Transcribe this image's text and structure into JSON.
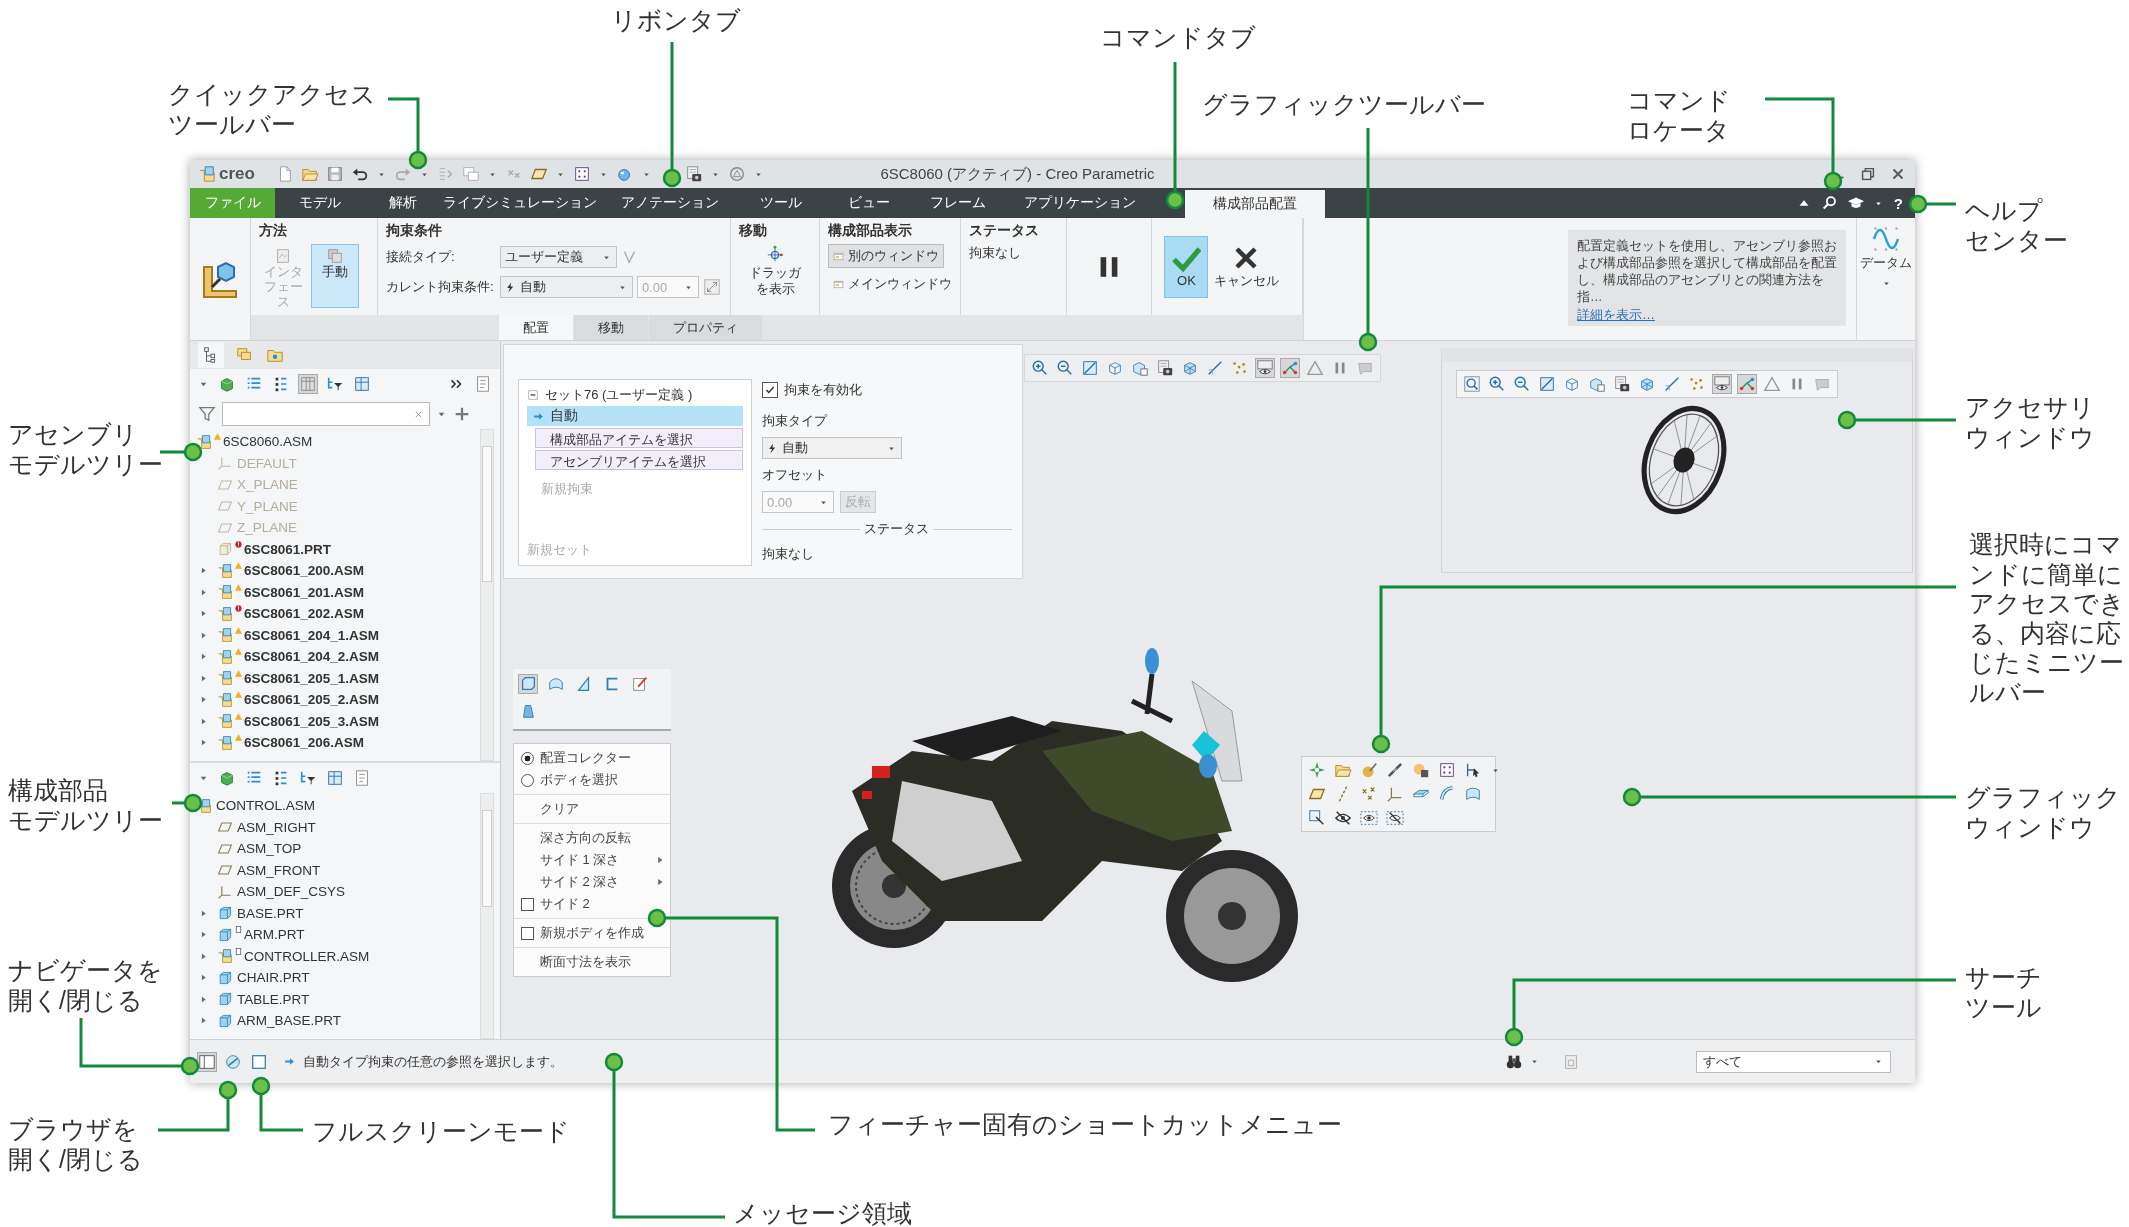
{
  "window": {
    "logo": "creo",
    "title": "6SC8060 (アクティブ) - Creo Parametric"
  },
  "ribbon_tabs": [
    {
      "label": "ファイル",
      "kind": "file",
      "selected": false
    },
    {
      "label": "モデル",
      "kind": "standard",
      "selected": false
    },
    {
      "label": "解析",
      "kind": "standard",
      "selected": false
    },
    {
      "label": "ライブシミュレーション",
      "kind": "standard",
      "selected": false
    },
    {
      "label": "アノテーション",
      "kind": "standard",
      "selected": false
    },
    {
      "label": "ツール",
      "kind": "standard",
      "selected": false
    },
    {
      "label": "ビュー",
      "kind": "standard",
      "selected": false
    },
    {
      "label": "フレーム",
      "kind": "standard",
      "selected": false
    },
    {
      "label": "アプリケーション",
      "kind": "standard",
      "selected": false
    },
    {
      "label": "構成部品配置",
      "kind": "standard",
      "selected": true
    }
  ],
  "help_button": "?",
  "ribbon": {
    "method": {
      "title": "方法",
      "buttons": [
        {
          "label": "インタフェース",
          "selected": false,
          "disabled": true
        },
        {
          "label": "手動",
          "selected": true,
          "disabled": false
        }
      ]
    },
    "constraints": {
      "title": "拘束条件",
      "connection_label": "接続タイプ:",
      "connection_value": "ユーザー定義",
      "current_label": "カレント拘束条件:",
      "current_value": "自動",
      "offset_value": "0.00"
    },
    "move": {
      "title": "移動",
      "button": "ドラッガを表示"
    },
    "component_display": {
      "title": "構成部品表示",
      "buttons": [
        {
          "label": "別のウィンドウ",
          "selected": true
        },
        {
          "label": "メインウィンドウ",
          "selected": false
        }
      ]
    },
    "status": {
      "title": "ステータス",
      "text": "拘束なし"
    },
    "ok": {
      "label": "OK",
      "selected": true
    },
    "cancel": {
      "label": "キャンセル"
    },
    "info": {
      "text": "配置定義セットを使用し、アセンブリ参照および構成部品参照を選択して構成部品を配置し、構成部品のアセンブリとの関連方法を指…",
      "link": "詳細を表示…"
    },
    "datum": {
      "label": "データム"
    }
  },
  "dashboard_tabs": [
    {
      "label": "配置",
      "selected": true
    },
    {
      "label": "移動",
      "selected": false
    },
    {
      "label": "プロパティ",
      "selected": false
    }
  ],
  "assembly_tree": {
    "root": {
      "name": "6SC8060.ASM",
      "kind": "assembly",
      "warning": true,
      "error": false,
      "note": false,
      "highlighted": false,
      "dimmed": false,
      "children": [
        {
          "name": "DEFAULT",
          "kind": "csys",
          "warning": false,
          "error": false,
          "note": false,
          "has_children": false,
          "highlighted": false,
          "dimmed": true
        },
        {
          "name": "X_PLANE",
          "kind": "plane",
          "warning": false,
          "error": false,
          "note": false,
          "has_children": false,
          "highlighted": false,
          "dimmed": true
        },
        {
          "name": "Y_PLANE",
          "kind": "plane",
          "warning": false,
          "error": false,
          "note": false,
          "has_children": false,
          "highlighted": false,
          "dimmed": true
        },
        {
          "name": "Z_PLANE",
          "kind": "plane",
          "warning": false,
          "error": false,
          "note": false,
          "has_children": false,
          "highlighted": false,
          "dimmed": true
        },
        {
          "name": "6SC8061.PRT",
          "kind": "part_light",
          "warning": false,
          "error": true,
          "note": false,
          "has_children": false,
          "highlighted": true,
          "dimmed": false
        },
        {
          "name": "6SC8061_200.ASM",
          "kind": "assembly",
          "warning": true,
          "error": false,
          "note": false,
          "has_children": true,
          "highlighted": true,
          "dimmed": false
        },
        {
          "name": "6SC8061_201.ASM",
          "kind": "assembly",
          "warning": true,
          "error": false,
          "note": false,
          "has_children": true,
          "highlighted": true,
          "dimmed": false
        },
        {
          "name": "6SC8061_202.ASM",
          "kind": "assembly",
          "warning": false,
          "error": true,
          "note": false,
          "has_children": true,
          "highlighted": true,
          "dimmed": false
        },
        {
          "name": "6SC8061_204_1.ASM",
          "kind": "assembly",
          "warning": true,
          "error": false,
          "note": false,
          "has_children": true,
          "highlighted": true,
          "dimmed": false
        },
        {
          "name": "6SC8061_204_2.ASM",
          "kind": "assembly",
          "warning": true,
          "error": false,
          "note": false,
          "has_children": true,
          "highlighted": true,
          "dimmed": false
        },
        {
          "name": "6SC8061_205_1.ASM",
          "kind": "assembly",
          "warning": true,
          "error": false,
          "note": false,
          "has_children": true,
          "highlighted": true,
          "dimmed": false
        },
        {
          "name": "6SC8061_205_2.ASM",
          "kind": "assembly",
          "warning": true,
          "error": false,
          "note": false,
          "has_children": true,
          "highlighted": true,
          "dimmed": false
        },
        {
          "name": "6SC8061_205_3.ASM",
          "kind": "assembly",
          "warning": true,
          "error": false,
          "note": false,
          "has_children": true,
          "highlighted": true,
          "dimmed": false
        },
        {
          "name": "6SC8061_206.ASM",
          "kind": "assembly",
          "warning": true,
          "error": false,
          "note": false,
          "has_children": true,
          "highlighted": true,
          "dimmed": false
        }
      ]
    }
  },
  "component_tree": {
    "root": {
      "name": "CONTROL.ASM",
      "kind": "assembly",
      "warning": false,
      "error": false,
      "note": false,
      "highlighted": false,
      "dimmed": false,
      "children": [
        {
          "name": "ASM_RIGHT",
          "kind": "plane",
          "warning": false,
          "error": false,
          "note": false,
          "has_children": false,
          "highlighted": false,
          "dimmed": false
        },
        {
          "name": "ASM_TOP",
          "kind": "plane",
          "warning": false,
          "error": false,
          "note": false,
          "has_children": false,
          "highlighted": false,
          "dimmed": false
        },
        {
          "name": "ASM_FRONT",
          "kind": "plane",
          "warning": false,
          "error": false,
          "note": false,
          "has_children": false,
          "highlighted": false,
          "dimmed": false
        },
        {
          "name": "ASM_DEF_CSYS",
          "kind": "csys",
          "warning": false,
          "error": false,
          "note": false,
          "has_children": false,
          "highlighted": false,
          "dimmed": false
        },
        {
          "name": "BASE.PRT",
          "kind": "part",
          "warning": false,
          "error": false,
          "note": false,
          "has_children": true,
          "highlighted": false,
          "dimmed": false
        },
        {
          "name": "ARM.PRT",
          "kind": "part",
          "warning": false,
          "error": false,
          "note": true,
          "has_children": true,
          "highlighted": false,
          "dimmed": false
        },
        {
          "name": "CONTROLLER.ASM",
          "kind": "assembly",
          "warning": false,
          "error": false,
          "note": true,
          "has_children": true,
          "highlighted": false,
          "dimmed": false
        },
        {
          "name": "CHAIR.PRT",
          "kind": "part",
          "warning": false,
          "error": false,
          "note": false,
          "has_children": true,
          "highlighted": false,
          "dimmed": false
        },
        {
          "name": "TABLE.PRT",
          "kind": "part",
          "warning": false,
          "error": false,
          "note": false,
          "has_children": true,
          "highlighted": false,
          "dimmed": false
        },
        {
          "name": "ARM_BASE.PRT",
          "kind": "part",
          "warning": false,
          "error": false,
          "note": false,
          "has_children": true,
          "highlighted": false,
          "dimmed": false
        }
      ]
    }
  },
  "placement_panel": {
    "set_title": "セット76 (ユーザー定義 )",
    "set_expanded": true,
    "constraint": {
      "label": "自動",
      "selected": true
    },
    "references": [
      "構成部品アイテムを選択",
      "アセンブリアイテムを選択"
    ],
    "new_constraint": "新規拘束",
    "new_set": "新規セット",
    "enable_constraint": {
      "label": "拘束を有効化",
      "checked": true
    },
    "constraint_type_label": "拘束タイプ",
    "constraint_type_value": "自動",
    "offset_label": "オフセット",
    "offset_value": "0.00",
    "offset_disabled": true,
    "flip": {
      "label": "反転",
      "disabled": true
    },
    "status_label": "ステータス",
    "status_text": "拘束なし"
  },
  "graphic_toolbar": [
    {
      "on": false
    },
    {
      "on": false
    },
    {
      "on": false
    },
    {
      "on": false
    },
    {
      "on": false
    },
    {
      "on": false
    },
    {
      "on": false
    },
    {
      "on": false
    },
    {
      "on": false
    },
    {
      "on": true
    },
    {
      "on": true
    },
    {
      "on": false
    },
    {
      "on": false
    },
    {
      "on": false
    }
  ],
  "accessory_toolbar": [
    {
      "on": false
    },
    {
      "on": false
    },
    {
      "on": false
    },
    {
      "on": false
    },
    {
      "on": false
    },
    {
      "on": false
    },
    {
      "on": false
    },
    {
      "on": false
    },
    {
      "on": false
    },
    {
      "on": false
    },
    {
      "on": true
    },
    {
      "on": true
    },
    {
      "on": false
    },
    {
      "on": false
    },
    {
      "on": false
    }
  ],
  "shortcut_toolbar": [
    {
      "on": true
    },
    {
      "on": false
    },
    {
      "on": false
    },
    {
      "on": false
    },
    {
      "on": false
    },
    {
      "on": false
    }
  ],
  "shortcut_menu": [
    [
      {
        "kind": "radio",
        "label": "配置コレクター",
        "checked": true
      },
      {
        "kind": "radio",
        "label": "ボディを選択",
        "checked": false
      }
    ],
    [
      {
        "kind": "action",
        "label": "クリア"
      }
    ],
    [
      {
        "kind": "action",
        "label": "深さ方向の反転"
      },
      {
        "kind": "submenu",
        "label": "サイド 1 深さ"
      },
      {
        "kind": "submenu",
        "label": "サイド 2 深さ"
      },
      {
        "kind": "checkbox",
        "label": "サイド 2",
        "checked": false
      }
    ],
    [
      {
        "kind": "checkbox",
        "label": "新規ボディを作成",
        "checked": false
      }
    ],
    [
      {
        "kind": "action",
        "label": "断面寸法を表示"
      }
    ]
  ],
  "status_bar": {
    "message": "自動タイプ拘束の任意の参照を選択します。",
    "filter": "すべて"
  },
  "callouts": [
    {
      "lines": [
        "クイックアクセス",
        "ツールバー"
      ]
    },
    {
      "lines": [
        "リボンタブ"
      ]
    },
    {
      "lines": [
        "コマンドタブ"
      ]
    },
    {
      "lines": [
        "グラフィックツールバー"
      ]
    },
    {
      "lines": [
        "コマンド",
        "ロケータ"
      ]
    },
    {
      "lines": [
        "ヘルプ",
        "センター"
      ]
    },
    {
      "lines": [
        "アセンブリ",
        "モデルツリー"
      ]
    },
    {
      "lines": [
        "アクセサリ",
        "ウィンドウ"
      ]
    },
    {
      "lines": [
        "選択時にコマ",
        "ンドに簡単に",
        "アクセスでき",
        "る、内容に応",
        "じたミニツー",
        "ルバー"
      ]
    },
    {
      "lines": [
        "構成部品",
        "モデルツリー"
      ]
    },
    {
      "lines": [
        "グラフィック",
        "ウィンドウ"
      ]
    },
    {
      "lines": [
        "サーチ",
        "ツール"
      ]
    },
    {
      "lines": [
        "ナビゲータを",
        "開く/閉じる"
      ]
    },
    {
      "lines": [
        "ブラウザを",
        "開く/閉じる"
      ]
    },
    {
      "lines": [
        "フルスクリーンモード"
      ]
    },
    {
      "lines": [
        "フィーチャー固有のショートカットメニュー"
      ]
    },
    {
      "lines": [
        "メッセージ領域"
      ]
    }
  ]
}
